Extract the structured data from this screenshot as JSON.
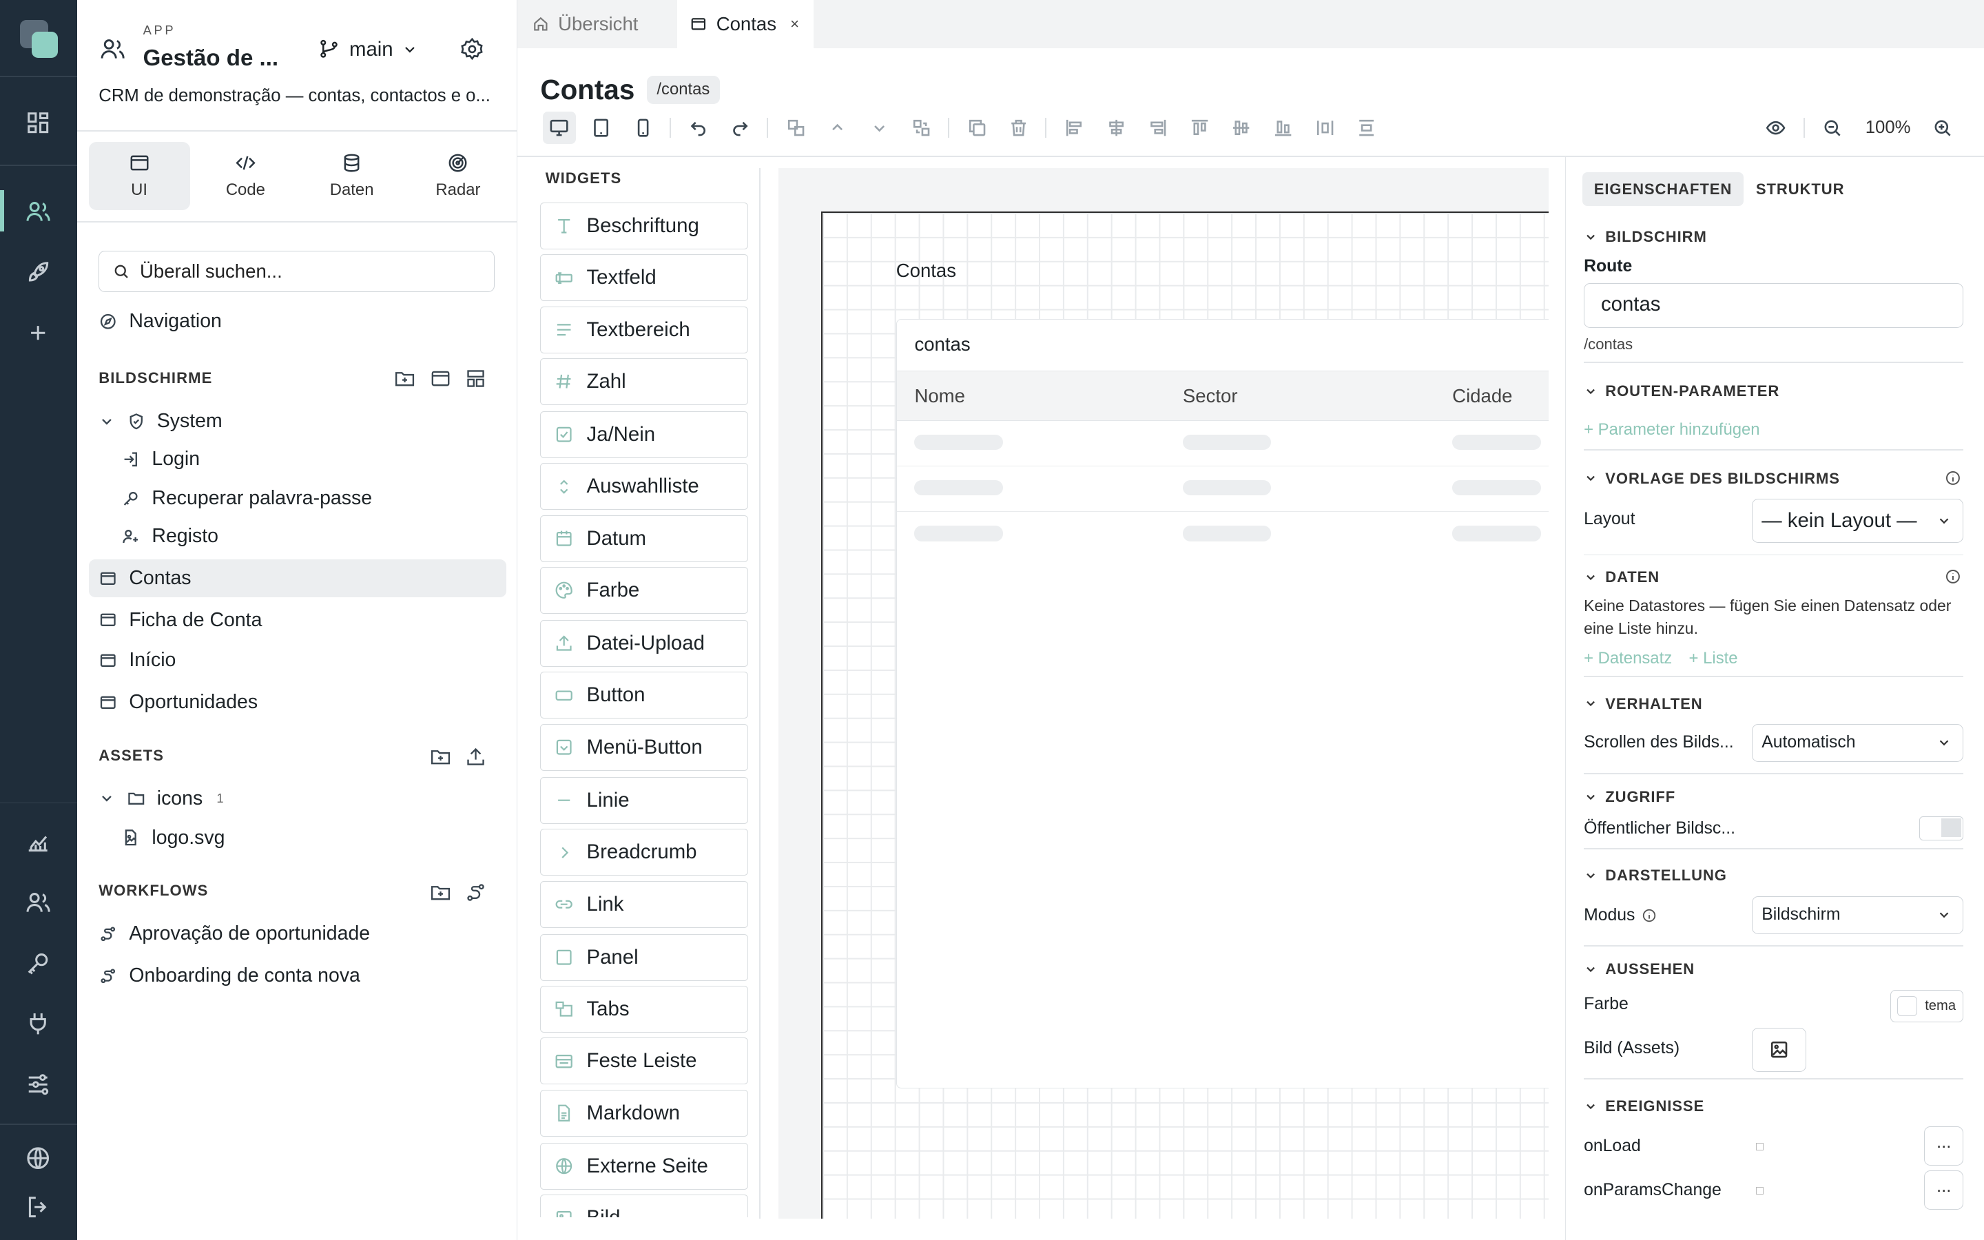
{
  "app": {
    "caption": "APP",
    "title": "Gestão de ...",
    "description": "CRM de demonstração — contas, contactos e o...",
    "branch": "main"
  },
  "rail": {
    "icons": [
      "dashboard-icon",
      "users-icon",
      "rocket-icon",
      "plus-icon",
      "chart-icon",
      "team-icon",
      "key-icon",
      "plug-icon",
      "sliders-icon",
      "globe-icon",
      "logout-icon"
    ]
  },
  "view_tabs": [
    {
      "label": "UI",
      "icon": "browser-icon"
    },
    {
      "label": "Code",
      "icon": "code-icon"
    },
    {
      "label": "Daten",
      "icon": "database-icon"
    },
    {
      "label": "Radar",
      "icon": "radar-icon"
    }
  ],
  "search": {
    "placeholder": "Überall suchen..."
  },
  "navigation_label": "Navigation",
  "screens": {
    "heading": "BILDSCHIRME",
    "group": "System",
    "system_items": [
      "Login",
      "Recuperar palavra-passe",
      "Registo"
    ],
    "items": [
      "Contas",
      "Ficha de Conta",
      "Início",
      "Oportunidades"
    ],
    "selected": "Contas"
  },
  "assets": {
    "heading": "ASSETS",
    "folder": "icons",
    "folder_count": "1",
    "file": "logo.svg"
  },
  "workflows": {
    "heading": "WORKFLOWS",
    "items": [
      "Aprovação de oportunidade",
      "Onboarding de conta nova"
    ]
  },
  "editor_tabs": [
    {
      "label": "Übersicht",
      "icon": "home-icon",
      "active": false
    },
    {
      "label": "Contas",
      "icon": "browser-icon",
      "active": true,
      "close": "×"
    }
  ],
  "page": {
    "title": "Contas",
    "route": "/contas"
  },
  "toolbar": {
    "zoom": "100%"
  },
  "widgets": {
    "heading": "WIDGETS",
    "items": [
      {
        "label": "Beschriftung",
        "icon": "text-icon"
      },
      {
        "label": "Textfeld",
        "icon": "input-icon"
      },
      {
        "label": "Textbereich",
        "icon": "textarea-icon"
      },
      {
        "label": "Zahl",
        "icon": "hash-icon"
      },
      {
        "label": "Ja/Nein",
        "icon": "checkbox-icon"
      },
      {
        "label": "Auswahlliste",
        "icon": "select-icon"
      },
      {
        "label": "Datum",
        "icon": "calendar-icon"
      },
      {
        "label": "Farbe",
        "icon": "palette-icon"
      },
      {
        "label": "Datei-Upload",
        "icon": "upload-icon"
      },
      {
        "label": "Button",
        "icon": "button-icon"
      },
      {
        "label": "Menü-Button",
        "icon": "menu-button-icon"
      },
      {
        "label": "Linie",
        "icon": "line-icon"
      },
      {
        "label": "Breadcrumb",
        "icon": "chevron-right-icon"
      },
      {
        "label": "Link",
        "icon": "link-icon"
      },
      {
        "label": "Panel",
        "icon": "panel-icon"
      },
      {
        "label": "Tabs",
        "icon": "tabs-icon"
      },
      {
        "label": "Feste Leiste",
        "icon": "bar-icon"
      },
      {
        "label": "Markdown",
        "icon": "document-icon"
      },
      {
        "label": "Externe Seite",
        "icon": "globe-icon"
      },
      {
        "label": "Bild",
        "icon": "image-icon"
      }
    ]
  },
  "canvas": {
    "screen_title": "Contas",
    "table_name": "contas",
    "columns": [
      "Nome",
      "Sector",
      "Cidade"
    ],
    "placeholder_rows": 3
  },
  "props": {
    "tabs": [
      "EIGENSCHAFTEN",
      "STRUKTUR"
    ],
    "screen": {
      "heading": "BILDSCHIRM",
      "route_label": "Route",
      "route_value": "contas",
      "route_hint": "/contas"
    },
    "params": {
      "heading": "ROUTEN-PARAMETER",
      "add": "+ Parameter hinzufügen"
    },
    "template": {
      "heading": "VORLAGE DES BILDSCHIRMS",
      "layout_label": "Layout",
      "layout_value": "— kein Layout —"
    },
    "data": {
      "heading": "DATEN",
      "text": "Keine Datastores — fügen Sie einen Datensatz oder eine Liste hinzu.",
      "add_record": "+ Datensatz",
      "add_list": "+ Liste"
    },
    "behavior": {
      "heading": "VERHALTEN",
      "scroll_label": "Scrollen des Bilds...",
      "scroll_value": "Automatisch"
    },
    "access": {
      "heading": "ZUGRIFF",
      "public_label": "Öffentlicher Bildsc..."
    },
    "display": {
      "heading": "DARSTELLUNG",
      "mode_label": "Modus",
      "mode_value": "Bildschirm"
    },
    "appearance": {
      "heading": "AUSSEHEN",
      "color_label": "Farbe",
      "color_value": "tema",
      "image_label": "Bild (Assets)"
    },
    "events": {
      "heading": "EREIGNISSE",
      "items": [
        "onLoad",
        "onParamsChange"
      ],
      "button": "..."
    }
  },
  "colors": {
    "rail_bg": "#1f2d3a",
    "accent": "#8fd0c3",
    "widget_icon": "#8fbfb4",
    "selected_bg": "#eceef0"
  }
}
